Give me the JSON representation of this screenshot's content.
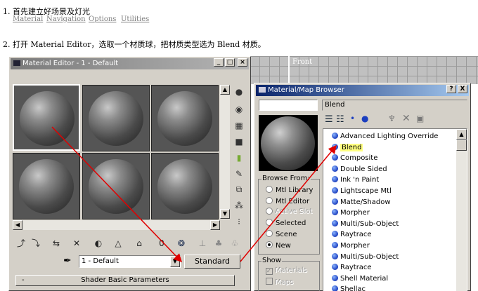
{
  "steps": {
    "s1": "1. 首先建立好场景及灯光",
    "s2": "2. 打开 Material Editor，选取一个材质球，把材质类型选为 Blend 材质。"
  },
  "viewport": {
    "label": "Front"
  },
  "material_editor": {
    "title": "Material Editor - 1 - Default",
    "menu": [
      "Material",
      "Navigation",
      "Options",
      "Utilities"
    ],
    "material_name": "1 - Default",
    "type_button": "Standard",
    "rollout_title": "Shader Basic Parameters",
    "rollout_toggle": "-"
  },
  "browser": {
    "title": "Material/Map Browser",
    "help_button": "?",
    "close_button": "X",
    "search_value": "Blend",
    "selected_name": "Blend",
    "browse_from": {
      "title": "Browse From:",
      "options": [
        {
          "label": "Mtl Library",
          "checked": false,
          "disabled": false
        },
        {
          "label": "Mtl Editor",
          "checked": false,
          "disabled": false
        },
        {
          "label": "Active Slot",
          "checked": false,
          "disabled": true
        },
        {
          "label": "Selected",
          "checked": false,
          "disabled": false
        },
        {
          "label": "Scene",
          "checked": false,
          "disabled": false
        },
        {
          "label": "New",
          "checked": true,
          "disabled": false
        }
      ]
    },
    "show": {
      "title": "Show",
      "materials": "Materials",
      "maps": "Maps"
    },
    "items": [
      "Advanced Lighting Override",
      "Blend",
      "Composite",
      "Double Sided",
      "Ink 'n Paint",
      "Lightscape Mtl",
      "Matte/Shadow",
      "Morpher",
      "Multi/Sub-Object",
      "Raytrace",
      "Morpher",
      "Multi/Sub-Object",
      "Raytrace",
      "Shell Material",
      "Shellac"
    ],
    "highlight_index": 1
  },
  "colors": {
    "arrow": "#e00000",
    "title_active": "#0a246a",
    "highlight": "#ffff80"
  }
}
